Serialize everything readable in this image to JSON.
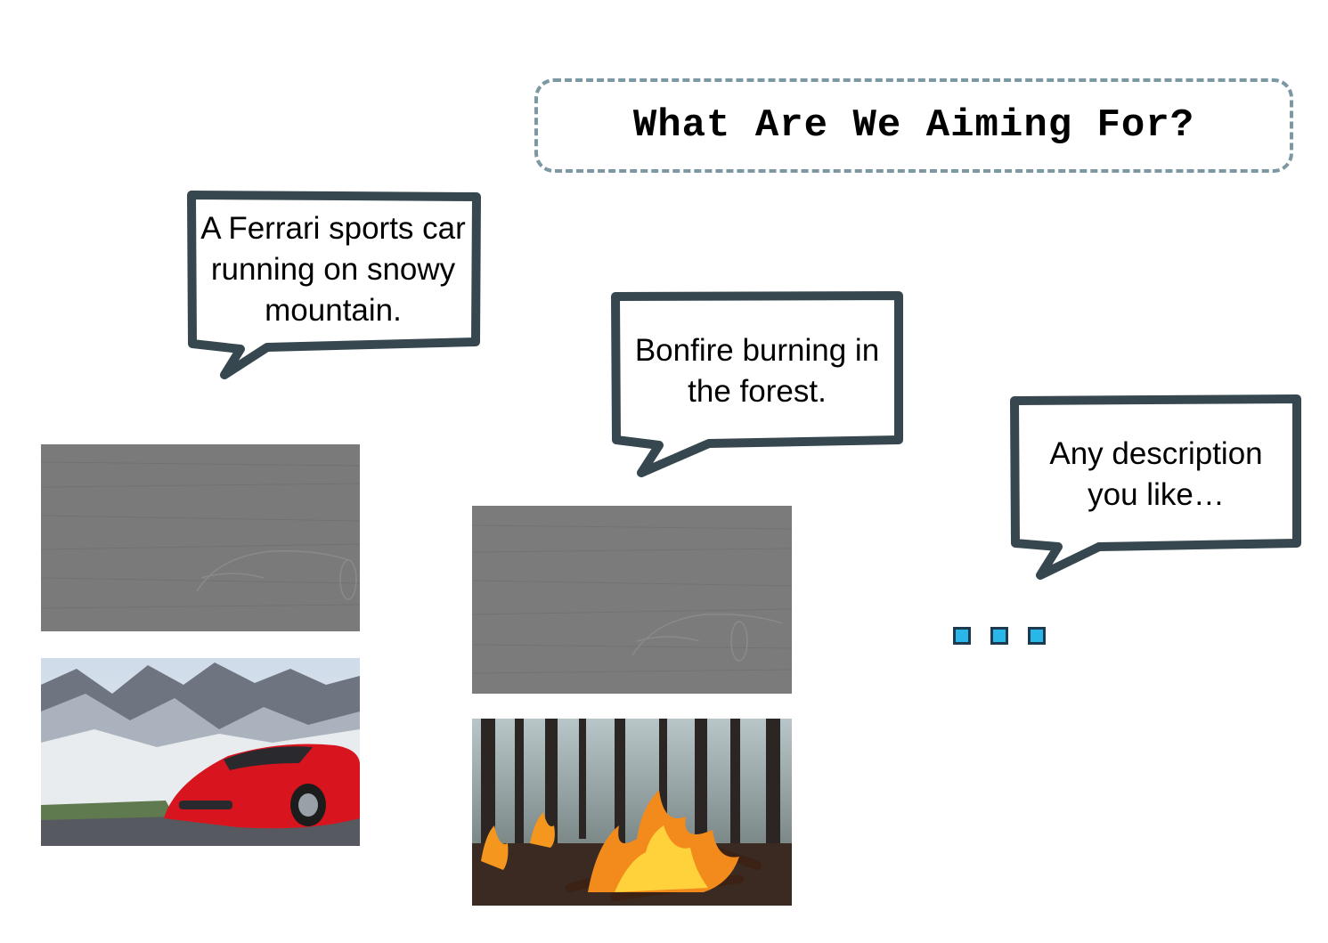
{
  "title": "What Are We Aiming For?",
  "prompts": [
    "A Ferrari sports car running on snowy mountain.",
    "Bonfire burning in the forest.",
    "Any description you like…"
  ],
  "panels": [
    {
      "kind": "noise",
      "subject": "ferrari"
    },
    {
      "kind": "generated",
      "subject": "ferrari-snowy-mountain"
    },
    {
      "kind": "noise",
      "subject": "bonfire"
    },
    {
      "kind": "generated",
      "subject": "bonfire-forest"
    }
  ],
  "colors": {
    "bubble_stroke": "#37474f",
    "title_border": "#7b98a3",
    "dot_fill": "#29b6e8",
    "noise_gray": "#7a7a7a"
  },
  "icons": [
    "speech-bubble-icon",
    "ellipsis-dots-icon"
  ]
}
